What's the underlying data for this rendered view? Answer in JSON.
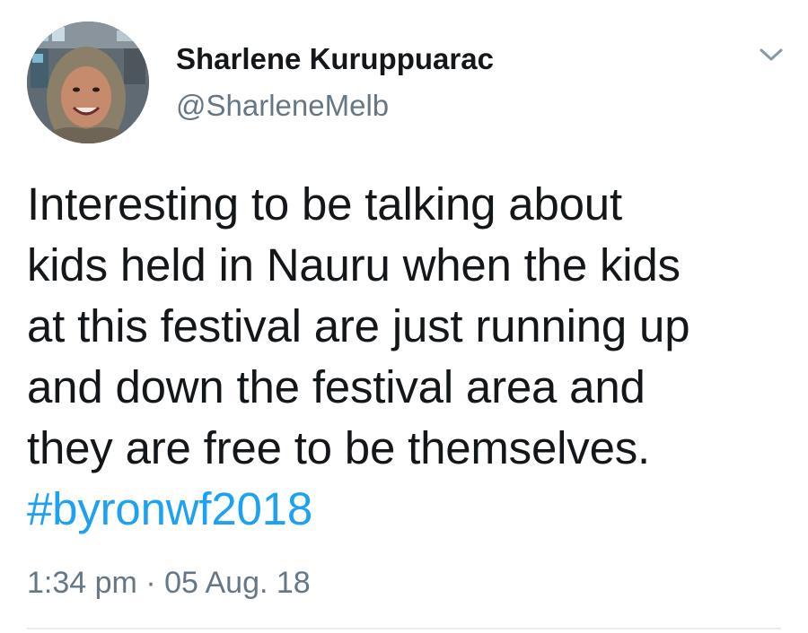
{
  "tweet": {
    "author": {
      "display_name": "Sharlene Kuruppuarac",
      "handle": "@SharleneMelb",
      "avatar_icon": "user-avatar-photo"
    },
    "menu_icon": "chevron-down-icon",
    "text_lines": [
      "Interesting to be talking about",
      "kids held in Nauru when the kids",
      "at this festival are just running up",
      "and down the festival area and",
      "they are free to be themselves."
    ],
    "hashtag": "#byronwf2018",
    "time": "1:34 pm",
    "separator": "·",
    "date": "05 Aug. 18"
  },
  "colors": {
    "text": "#14171a",
    "secondary": "#657786",
    "link": "#1da1f2",
    "divider": "#e6ecf0"
  }
}
